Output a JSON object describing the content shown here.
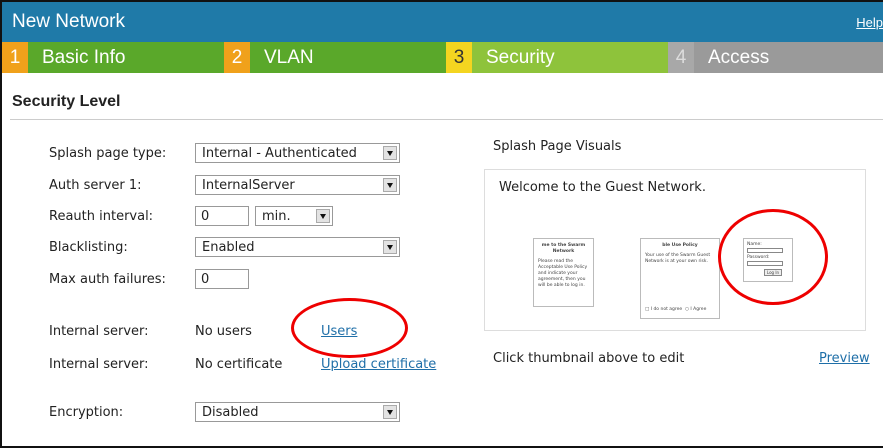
{
  "header": {
    "title": "New Network",
    "help": "Help"
  },
  "steps": [
    {
      "num": "1",
      "label": "Basic Info"
    },
    {
      "num": "2",
      "label": "VLAN"
    },
    {
      "num": "3",
      "label": "Security"
    },
    {
      "num": "4",
      "label": "Access"
    }
  ],
  "section_title": "Security Level",
  "form": {
    "splash_page_type": {
      "label": "Splash page type:",
      "value": "Internal - Authenticated"
    },
    "auth_server_1": {
      "label": "Auth server 1:",
      "value": "InternalServer"
    },
    "reauth_interval": {
      "label": "Reauth interval:",
      "value": "0",
      "unit": "min."
    },
    "blacklisting": {
      "label": "Blacklisting:",
      "value": "Enabled"
    },
    "max_auth_failures": {
      "label": "Max auth failures:",
      "value": "0"
    },
    "internal_server_users": {
      "label": "Internal server:",
      "status": "No users",
      "link": "Users"
    },
    "internal_server_cert": {
      "label": "Internal server:",
      "status": "No certificate",
      "link": "Upload certificate"
    },
    "encryption": {
      "label": "Encryption:",
      "value": "Disabled"
    }
  },
  "visuals": {
    "title": "Splash Page Visuals",
    "welcome": "Welcome to the Guest Network.",
    "thumb1_title": "me to the Swarm Network",
    "thumb1_body": "Please read the Acceptable Use Policy and indicate your agreement, then you will be able to log in.",
    "thumb2_title": "ble Use Policy",
    "thumb2_body": "Your use of the Swarm Guest Network is at your own risk.",
    "thumb2_disagree": "I do not agree",
    "thumb2_agree": "I Agree",
    "thumb3_name": "Name:",
    "thumb3_password": "Password:",
    "thumb3_login": "Log In",
    "hint": "Click thumbnail above to edit",
    "preview": "Preview"
  },
  "colors": {
    "header_bg": "#1f7aa8",
    "step_green": "#5aa82a",
    "step_active": "#8ec33b",
    "step_disabled": "#9a9a9a",
    "step_num_orange": "#f0a11b",
    "step_num_yellow": "#f4d520",
    "link": "#1f6fa8",
    "annotation_red": "#ee0000"
  }
}
